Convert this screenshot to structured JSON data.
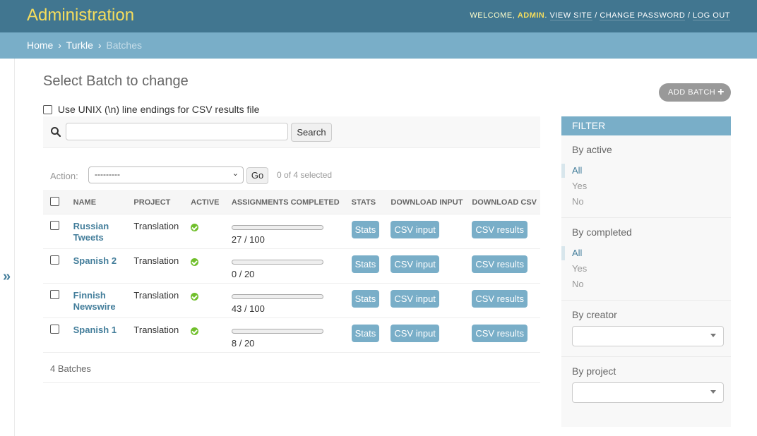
{
  "header": {
    "branding": "Administration",
    "welcome": "Welcome,",
    "user": "admin",
    "view_site": "View site",
    "change_password": "Change password",
    "log_out": "Log out"
  },
  "breadcrumbs": [
    "Home",
    "Turkle",
    "Batches"
  ],
  "page_title": "Select Batch to change",
  "add_batch_label": "Add Batch",
  "unix_label": "Use UNIX (\\n) line endings for CSV results file",
  "search": {
    "placeholder": "",
    "button": "Search"
  },
  "actions": {
    "label": "Action:",
    "selected": "---------",
    "go": "Go",
    "selection_count": "0 of 4 selected"
  },
  "columns": [
    "Name",
    "Project",
    "Active",
    "Assignments completed",
    "Stats",
    "Download input",
    "Download CSV"
  ],
  "rows": [
    {
      "name": "Russian Tweets",
      "project": "Translation",
      "active": true,
      "progress": 0.27,
      "progress_text": "27 / 100",
      "stats": "Stats",
      "input": "CSV input",
      "results": "CSV results"
    },
    {
      "name": "Spanish 2",
      "project": "Translation",
      "active": true,
      "progress": 0.0,
      "progress_text": "0 / 20",
      "stats": "Stats",
      "input": "CSV input",
      "results": "CSV results"
    },
    {
      "name": "Finnish Newswire",
      "project": "Translation",
      "active": true,
      "progress": 0.43,
      "progress_text": "43 / 100",
      "stats": "Stats",
      "input": "CSV input",
      "results": "CSV results"
    },
    {
      "name": "Spanish 1",
      "project": "Translation",
      "active": true,
      "progress": 0.4,
      "progress_text": "8 / 20",
      "stats": "Stats",
      "input": "CSV input",
      "results": "CSV results"
    }
  ],
  "paginator": "4 Batches",
  "filter": {
    "title": "Filter",
    "by_active": {
      "title": "By active",
      "options": [
        "All",
        "Yes",
        "No"
      ],
      "selected": "All"
    },
    "by_completed": {
      "title": "By completed",
      "options": [
        "All",
        "Yes",
        "No"
      ],
      "selected": "All"
    },
    "by_creator": {
      "title": "By creator",
      "value": ""
    },
    "by_project": {
      "title": "By project",
      "value": ""
    }
  },
  "colors": {
    "header": "#417690",
    "breadcrumbs": "#79aec8",
    "accent": "#447e9b",
    "progress": "#ed6c3c",
    "active": "#70bf2b"
  }
}
